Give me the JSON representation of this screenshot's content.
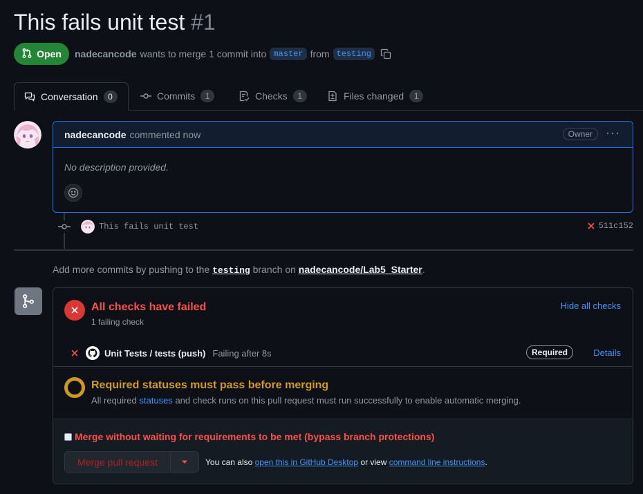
{
  "pr": {
    "title": "This fails unit test",
    "number": "#1",
    "state": "Open",
    "author": "nadecancode",
    "merge_text": "wants to merge 1 commit into",
    "base_branch": "master",
    "from_text": "from",
    "head_branch": "testing"
  },
  "tabs": [
    {
      "label": "Conversation",
      "count": "0",
      "icon": "comment-discussion-icon"
    },
    {
      "label": "Commits",
      "count": "1",
      "icon": "git-commit-icon"
    },
    {
      "label": "Checks",
      "count": "1",
      "icon": "checklist-icon"
    },
    {
      "label": "Files changed",
      "count": "1",
      "icon": "file-diff-icon"
    }
  ],
  "comment": {
    "author": "nadecancode",
    "time": "commented now",
    "role": "Owner",
    "body": "No description provided."
  },
  "commit": {
    "message": "This fails unit test",
    "sha": "511c152",
    "status": "failed"
  },
  "hint": {
    "prefix": "Add more commits by pushing to the",
    "branch": "testing",
    "middle": "branch on",
    "repo": "nadecancode/Lab5_Starter",
    "suffix": "."
  },
  "checks": {
    "title": "All checks have failed",
    "subtitle": "1 failing check",
    "hide_label": "Hide all checks",
    "items": [
      {
        "name": "Unit Tests / tests (push)",
        "status": "Failing after 8s",
        "badge": "Required",
        "details": "Details"
      }
    ]
  },
  "requirements": {
    "title": "Required statuses must pass before merging",
    "prefix": "All required",
    "link": "statuses",
    "suffix": "and check runs on this pull request must run successfully to enable automatic merging."
  },
  "merge": {
    "bypass_label": "Merge without waiting for requirements to be met (bypass branch protections)",
    "button": "Merge pull request",
    "alt_prefix": "You can also",
    "alt_link1": "open this in GitHub Desktop",
    "alt_middle": "or view",
    "alt_link2": "command line instructions",
    "alt_suffix": "."
  },
  "colors": {
    "open_green": "#238636",
    "fail_red": "#f85149",
    "pending_yellow": "#d29922",
    "link_blue": "#4493f8"
  }
}
